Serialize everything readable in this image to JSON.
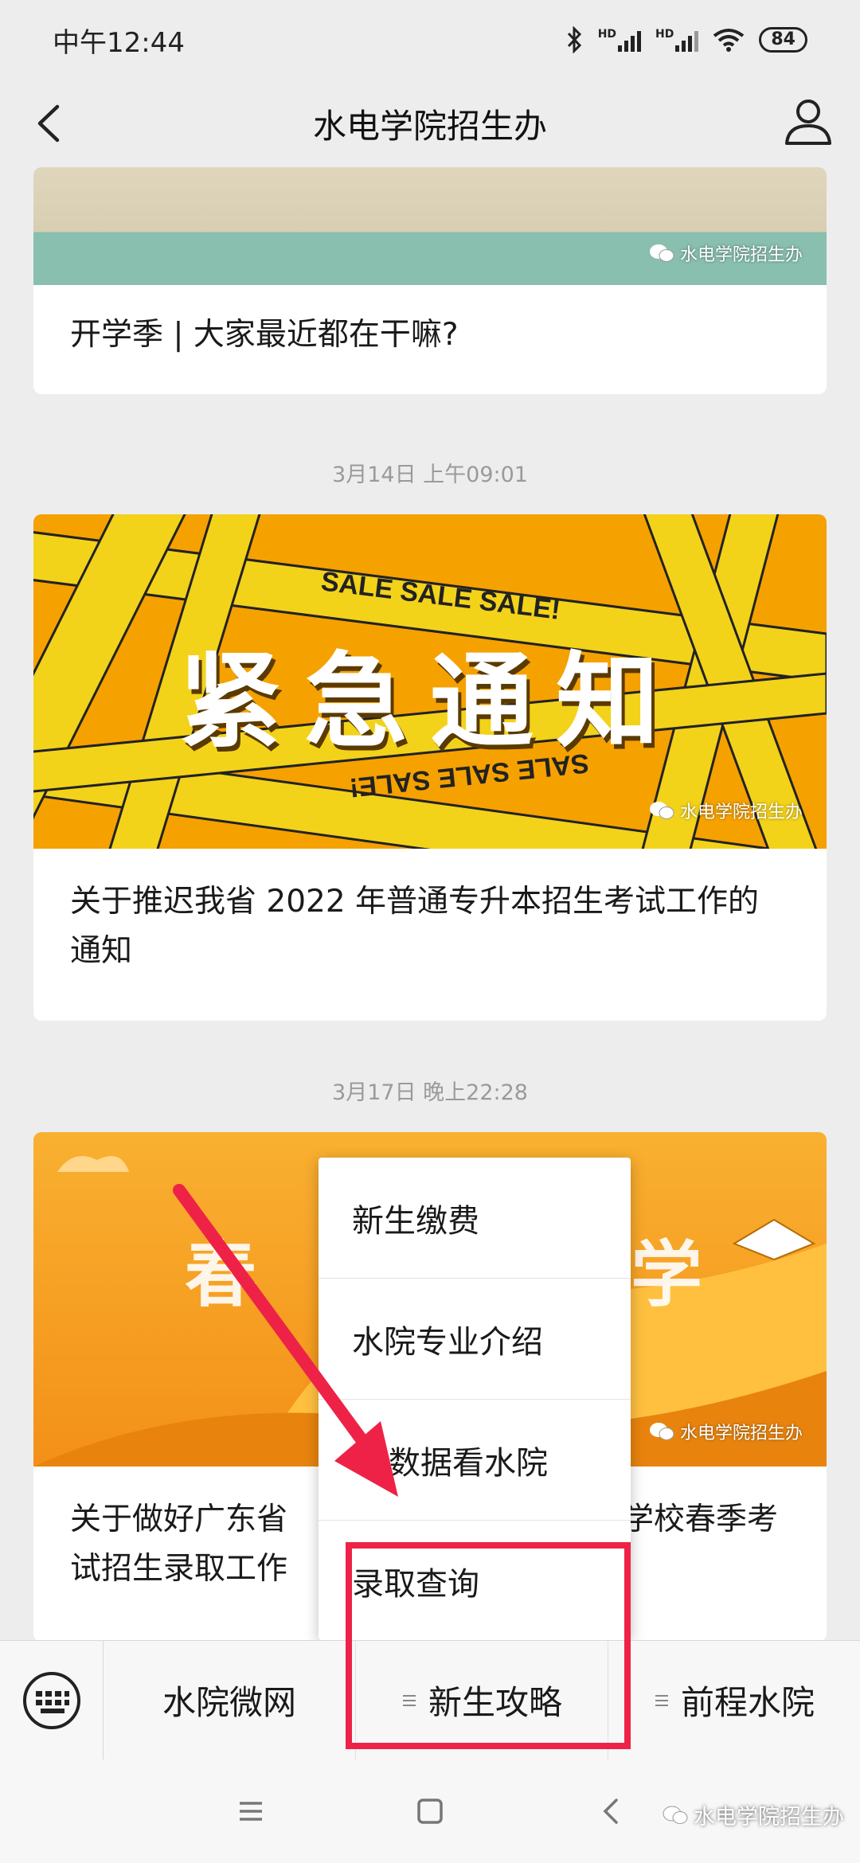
{
  "status_bar": {
    "time": "中午12:44",
    "hd1": "HD",
    "hd2": "HD",
    "battery": "84"
  },
  "nav": {
    "title": "水电学院招生办"
  },
  "articles": [
    {
      "title": "开学季 | 大家最近都在干嘛?",
      "watermark": "水电学院招生办"
    },
    {
      "timestamp": "3月14日 上午09:01",
      "banner_text": "紧急通知",
      "tape_text": "SALE SALE SALE!",
      "title": "关于推迟我省 2022 年普通专升本招生考试工作的通知",
      "watermark": "水电学院招生办"
    },
    {
      "timestamp": "3月17日 晚上22:28",
      "title_left_line1": "关于做好广东省",
      "title_left_line2": "试招生录取工作",
      "title_right": "学校春季考",
      "watermark": "水电学院招生办"
    }
  ],
  "popup_menu": {
    "items": [
      "新生缴费",
      "水院专业介绍",
      "数据看水院",
      "录取查询"
    ]
  },
  "bottom_menu": {
    "tabs": [
      "水院微网",
      "新生攻略",
      "前程水院"
    ]
  },
  "system_nav": {
    "watermark": "水电学院招生办"
  },
  "colors": {
    "accent_red": "#ee2246",
    "banner_yellow": "#f5a100",
    "tape_yellow": "#f3d21a",
    "spring_orange": "#f6a020"
  }
}
